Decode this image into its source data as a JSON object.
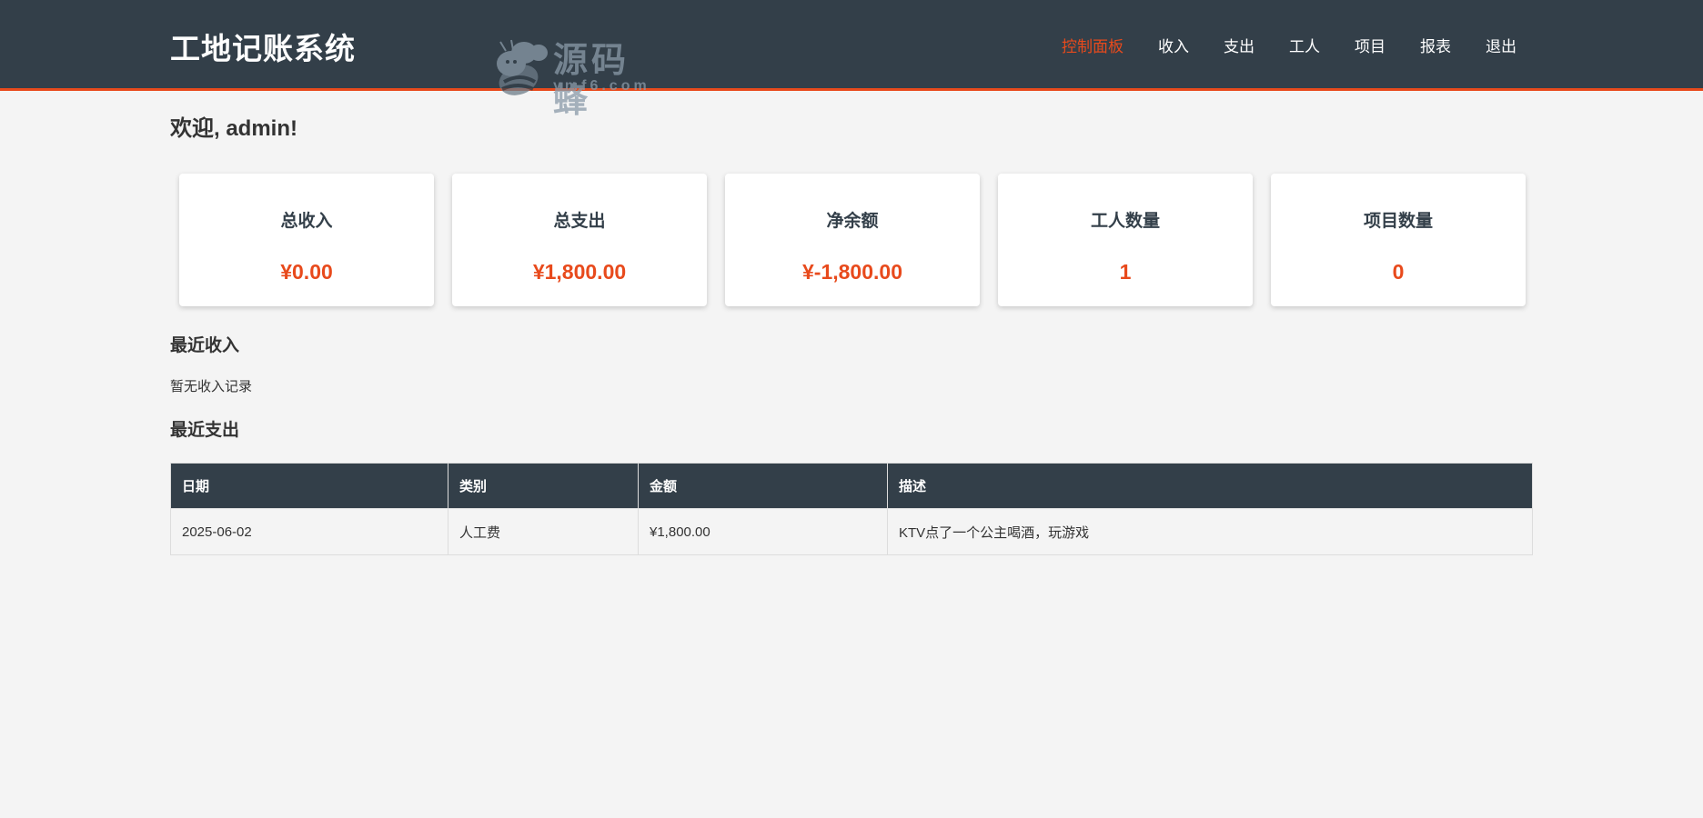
{
  "header": {
    "app_title": "工地记账系统",
    "watermark": {
      "text": "源码蜂",
      "sub": "ymf6.com"
    },
    "nav": [
      {
        "label": "控制面板",
        "active": true
      },
      {
        "label": "收入",
        "active": false
      },
      {
        "label": "支出",
        "active": false
      },
      {
        "label": "工人",
        "active": false
      },
      {
        "label": "项目",
        "active": false
      },
      {
        "label": "报表",
        "active": false
      },
      {
        "label": "退出",
        "active": false
      }
    ]
  },
  "welcome": "欢迎, admin!",
  "stats": [
    {
      "label": "总收入",
      "value": "¥0.00"
    },
    {
      "label": "总支出",
      "value": "¥1,800.00"
    },
    {
      "label": "净余额",
      "value": "¥-1,800.00"
    },
    {
      "label": "工人数量",
      "value": "1"
    },
    {
      "label": "项目数量",
      "value": "0"
    }
  ],
  "recent_income": {
    "title": "最近收入",
    "empty_text": "暂无收入记录"
  },
  "recent_expense": {
    "title": "最近支出",
    "columns": [
      "日期",
      "类别",
      "金额",
      "描述"
    ],
    "rows": [
      [
        "2025-06-02",
        "人工费",
        "¥1,800.00",
        "KTV点了一个公主喝酒，玩游戏"
      ]
    ]
  },
  "colors": {
    "header_bg": "#333f49",
    "accent": "#e84a1c",
    "page_bg": "#f4f4f4"
  }
}
